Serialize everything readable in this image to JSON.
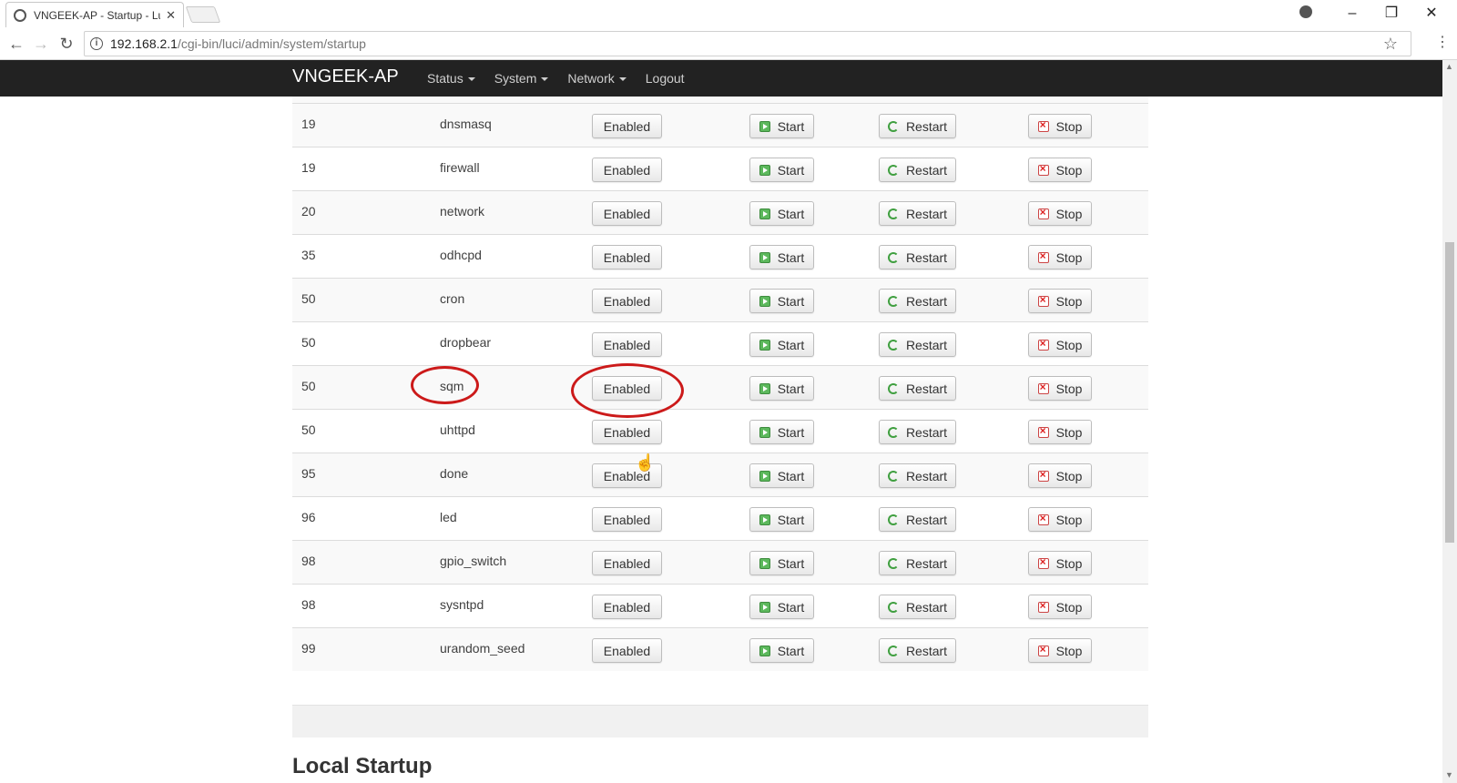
{
  "browser": {
    "tab_title": "VNGEEK-AP - Startup - Lu",
    "url_host": "192.168.2.1",
    "url_path": "/cgi-bin/luci/admin/system/startup"
  },
  "navbar": {
    "brand": "VNGEEK-AP",
    "menu": [
      "Status",
      "System",
      "Network",
      "Logout"
    ]
  },
  "buttons": {
    "enabled": "Enabled",
    "start": "Start",
    "restart": "Restart",
    "stop": "Stop"
  },
  "rows": [
    {
      "priority": "19",
      "service": "dnsmasq"
    },
    {
      "priority": "19",
      "service": "firewall"
    },
    {
      "priority": "20",
      "service": "network"
    },
    {
      "priority": "35",
      "service": "odhcpd"
    },
    {
      "priority": "50",
      "service": "cron"
    },
    {
      "priority": "50",
      "service": "dropbear"
    },
    {
      "priority": "50",
      "service": "sqm"
    },
    {
      "priority": "50",
      "service": "uhttpd"
    },
    {
      "priority": "95",
      "service": "done"
    },
    {
      "priority": "96",
      "service": "led"
    },
    {
      "priority": "98",
      "service": "gpio_switch"
    },
    {
      "priority": "98",
      "service": "sysntpd"
    },
    {
      "priority": "99",
      "service": "urandom_seed"
    }
  ],
  "local_startup_heading": "Local Startup",
  "annotation_color": "#cc1a1a"
}
